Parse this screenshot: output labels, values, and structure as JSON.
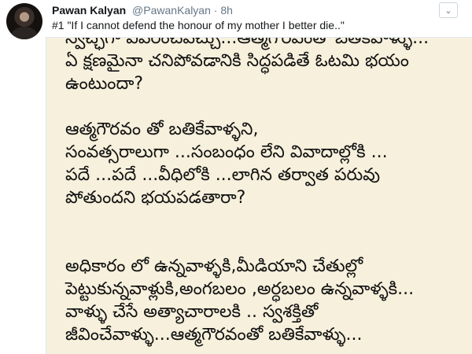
{
  "tweet": {
    "author_name": "Pawan Kalyan",
    "author_handle": "@PawanKalyan",
    "separator": "·",
    "time": "8h",
    "text": "#1 \"If I cannot defend the honour of my mother I better die..\"",
    "menu_icon": "chevron-down-icon"
  },
  "image": {
    "lines": [
      "స్వేచ్ఛగా వివరించవచ్చు...ఆత్మగౌరవంతో బతికేవాళ్ళు...",
      "ఏ క్షణమైనా చనిపోవడానికి సిద్ధపడితే  ఓటమి భయం",
      "ఉంటుందా?",
      "",
      "ఆత్మగౌరవం తో బతికేవాళ్ళని,",
      "సంవత్సరాలుగా ...సంబంధం లేని వివాదాల్లోకి ...",
      "పదే ...పదే ...వీధిలోకి ...లాగిన  తర్వాత పరువు",
      "పోతుందని భయపడతారా?",
      "",
      "",
      "అధికారం లో ఉన్నవాళ్ళకి,మీడియాని చేతుల్లో",
      "పెట్టుకున్నవాళ్లుకి,అంగబలం ,అర్ధబలం ఉన్నవాళ్ళకి...",
      "వాళ్ళు చేసే అత్యాచారాలకి .. స్వశక్తితో",
      "జీవించేవాళ్ళు...ఆత్మగౌరవంతో బతికేవాళ్ళు..."
    ]
  }
}
